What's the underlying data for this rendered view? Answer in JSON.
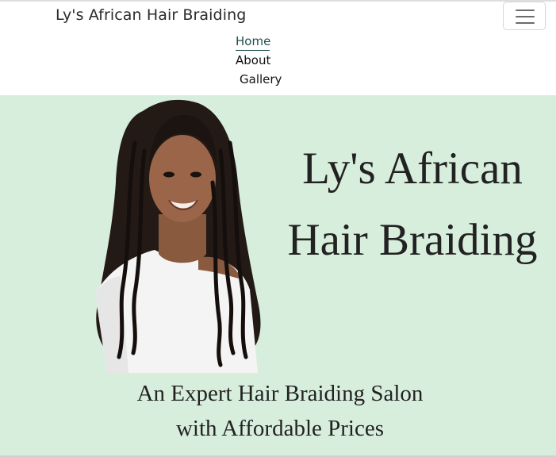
{
  "navbar": {
    "brand": "Ly's African Hair Braiding",
    "toggle_icon": "hamburger-menu-icon",
    "links": [
      {
        "label": "Home",
        "active": true
      },
      {
        "label": "About",
        "active": false
      },
      {
        "label": "Gallery",
        "active": false
      }
    ]
  },
  "hero": {
    "background_color": "#d8eedc",
    "title_lines": [
      "Ly's African",
      "Hair Braiding"
    ],
    "subtitle_lines": [
      "An Expert Hair Braiding Salon",
      "with Affordable Prices"
    ],
    "image": "woman-with-long-braids-photo"
  },
  "colors": {
    "active_link": "#1f4e4e",
    "text": "#222222"
  }
}
